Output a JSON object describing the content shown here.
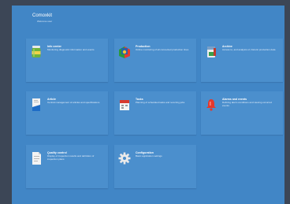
{
  "app": {
    "title": "Comoxkit",
    "subtitle": "Welcome user"
  },
  "tiles": [
    {
      "title": "Info center",
      "desc": "Monitoring diagnostic information and events",
      "icon": "jar-icon"
    },
    {
      "title": "Production",
      "desc": "Online monitoring of all connected production lines",
      "icon": "production-icon"
    },
    {
      "title": "Archive",
      "desc": "Access to, and analysis of, historic production data",
      "icon": "archive-icon"
    },
    {
      "title": "Article",
      "desc": "Central management of articles and specifications",
      "icon": "article-icon"
    },
    {
      "title": "Tasks",
      "desc": "Planning of scheduled tasks and recurring jobs",
      "icon": "calendar-icon"
    },
    {
      "title": "Alarms and events",
      "desc": "Defining alarm conditions and viewing occurred events",
      "icon": "alarm-icon"
    },
    {
      "title": "Quality control",
      "desc": "Display of inspection results and definition of inspection plans",
      "icon": "document-icon"
    },
    {
      "title": "Configuration",
      "desc": "Basic application settings",
      "icon": "gear-icon"
    }
  ]
}
